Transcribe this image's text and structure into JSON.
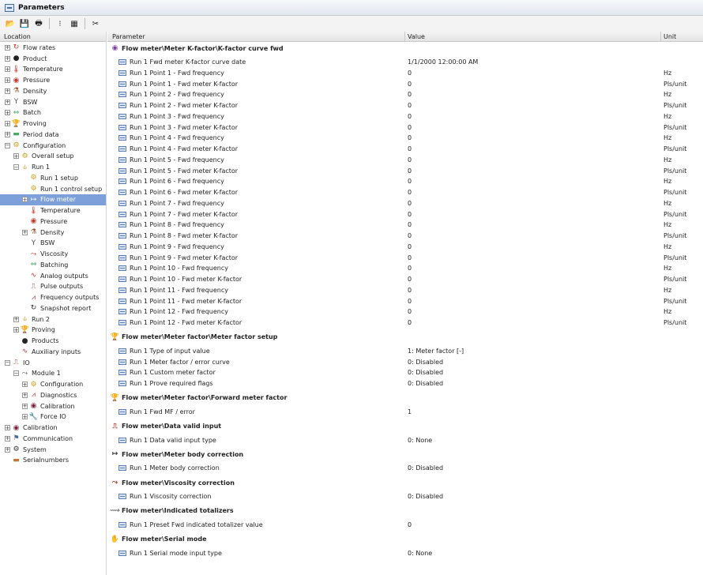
{
  "window": {
    "title": "Parameters"
  },
  "toolbar": [
    {
      "icon": "open-folder-icon",
      "glyph": "📂"
    },
    {
      "icon": "save-icon",
      "glyph": "💾"
    },
    {
      "icon": "print-icon",
      "glyph": "🖶"
    },
    {
      "icon": "sep"
    },
    {
      "icon": "tree-view-icon",
      "glyph": "⁝"
    },
    {
      "icon": "grid-view-icon",
      "glyph": "▦"
    },
    {
      "icon": "sep"
    },
    {
      "icon": "tools-icon",
      "glyph": "✂"
    }
  ],
  "tree": {
    "header": "Location",
    "nodes": [
      {
        "label": "Flow rates",
        "level": 0,
        "exp": "+",
        "icon": "flow-rates-icon",
        "glyph": "↻",
        "color": "#c0392b"
      },
      {
        "label": "Product",
        "level": 0,
        "exp": "+",
        "icon": "product-icon",
        "glyph": "●",
        "color": "#222"
      },
      {
        "label": "Temperature",
        "level": 0,
        "exp": "+",
        "icon": "temperature-icon",
        "glyph": "🌡",
        "color": "#c0392b"
      },
      {
        "label": "Pressure",
        "level": 0,
        "exp": "+",
        "icon": "pressure-icon",
        "glyph": "◉",
        "color": "#c0392b"
      },
      {
        "label": "Density",
        "level": 0,
        "exp": "+",
        "icon": "density-icon",
        "glyph": "⚗",
        "color": "#a0522d"
      },
      {
        "label": "BSW",
        "level": 0,
        "exp": "+",
        "icon": "bsw-icon",
        "glyph": "Y",
        "color": "#555"
      },
      {
        "label": "Batch",
        "level": 0,
        "exp": "+",
        "icon": "batch-icon",
        "glyph": "⇔",
        "color": "#4a6"
      },
      {
        "label": "Proving",
        "level": 0,
        "exp": "+",
        "icon": "proving-icon",
        "glyph": "🏆",
        "color": "#b8860b"
      },
      {
        "label": "Period data",
        "level": 0,
        "exp": "+",
        "icon": "period-data-icon",
        "glyph": "▬",
        "color": "#4a6"
      },
      {
        "label": "Configuration",
        "level": 0,
        "exp": "−",
        "icon": "configuration-icon",
        "glyph": "⚙",
        "color": "#d4a017"
      },
      {
        "label": "Overall setup",
        "level": 1,
        "exp": "+",
        "icon": "overall-setup-icon",
        "glyph": "⚙",
        "color": "#d4a017"
      },
      {
        "label": "Run 1",
        "level": 1,
        "exp": "−",
        "icon": "run-icon",
        "glyph": "⫝",
        "color": "#d4a017"
      },
      {
        "label": "Run 1 setup",
        "level": 2,
        "exp": "",
        "icon": "run-setup-icon",
        "glyph": "⚙",
        "color": "#d4a017"
      },
      {
        "label": "Run 1 control setup",
        "level": 2,
        "exp": "",
        "icon": "run-control-setup-icon",
        "glyph": "⚙",
        "color": "#d4a017"
      },
      {
        "label": "Flow meter",
        "level": 2,
        "exp": "+",
        "icon": "flow-meter-icon",
        "glyph": "↦",
        "color": "#fff",
        "selected": true
      },
      {
        "label": "Temperature",
        "level": 2,
        "exp": "",
        "icon": "temperature-icon",
        "glyph": "🌡",
        "color": "#c0392b"
      },
      {
        "label": "Pressure",
        "level": 2,
        "exp": "",
        "icon": "pressure-icon",
        "glyph": "◉",
        "color": "#c0392b"
      },
      {
        "label": "Density",
        "level": 2,
        "exp": "+",
        "icon": "density-icon",
        "glyph": "⚗",
        "color": "#a0522d"
      },
      {
        "label": "BSW",
        "level": 2,
        "exp": "",
        "icon": "bsw-icon",
        "glyph": "Y",
        "color": "#555"
      },
      {
        "label": "Viscosity",
        "level": 2,
        "exp": "",
        "icon": "viscosity-icon",
        "glyph": "⤳",
        "color": "#c0392b"
      },
      {
        "label": "Batching",
        "level": 2,
        "exp": "",
        "icon": "batching-icon",
        "glyph": "⇔",
        "color": "#4a6"
      },
      {
        "label": "Analog outputs",
        "level": 2,
        "exp": "",
        "icon": "analog-outputs-icon",
        "glyph": "∿",
        "color": "#c0392b"
      },
      {
        "label": "Pulse outputs",
        "level": 2,
        "exp": "",
        "icon": "pulse-outputs-icon",
        "glyph": "⎍",
        "color": "#c0392b"
      },
      {
        "label": "Frequency outputs",
        "level": 2,
        "exp": "",
        "icon": "frequency-outputs-icon",
        "glyph": "⩘",
        "color": "#c0392b"
      },
      {
        "label": "Snapshot report",
        "level": 2,
        "exp": "",
        "icon": "snapshot-report-icon",
        "glyph": "↻",
        "color": "#333"
      },
      {
        "label": "Run 2",
        "level": 1,
        "exp": "+",
        "icon": "run-icon",
        "glyph": "⫝",
        "color": "#d4a017"
      },
      {
        "label": "Proving",
        "level": 1,
        "exp": "+",
        "icon": "proving-icon",
        "glyph": "🏆",
        "color": "#b8860b"
      },
      {
        "label": "Products",
        "level": 1,
        "exp": "",
        "icon": "products-icon",
        "glyph": "●",
        "color": "#222"
      },
      {
        "label": "Auxiliary inputs",
        "level": 1,
        "exp": "",
        "icon": "auxiliary-inputs-icon",
        "glyph": "∿",
        "color": "#c0392b"
      },
      {
        "label": "IO",
        "level": 0,
        "exp": "−",
        "icon": "io-icon",
        "glyph": "⎍",
        "color": "#c0392b"
      },
      {
        "label": "Module 1",
        "level": 1,
        "exp": "−",
        "icon": "module-icon",
        "glyph": "⤳",
        "color": "#555"
      },
      {
        "label": "Configuration",
        "level": 2,
        "exp": "+",
        "icon": "configuration-icon",
        "glyph": "⚙",
        "color": "#d4a017"
      },
      {
        "label": "Diagnostics",
        "level": 2,
        "exp": "+",
        "icon": "diagnostics-icon",
        "glyph": "⩘",
        "color": "#c0392b"
      },
      {
        "label": "Calibration",
        "level": 2,
        "exp": "+",
        "icon": "calibration-icon",
        "glyph": "◉",
        "color": "#7a1f3d"
      },
      {
        "label": "Force IO",
        "level": 2,
        "exp": "+",
        "icon": "force-io-icon",
        "glyph": "🔧",
        "color": "#555"
      },
      {
        "label": "Calibration",
        "level": 0,
        "exp": "+",
        "icon": "calibration-icon",
        "glyph": "◉",
        "color": "#7a1f3d"
      },
      {
        "label": "Communication",
        "level": 0,
        "exp": "+",
        "icon": "communication-icon",
        "glyph": "⚑",
        "color": "#4a6b9a"
      },
      {
        "label": "System",
        "level": 0,
        "exp": "+",
        "icon": "system-icon",
        "glyph": "⚙",
        "color": "#333"
      },
      {
        "label": "Serialnumbers",
        "level": 0,
        "exp": "",
        "icon": "serialnumbers-icon",
        "glyph": "▬",
        "color": "#c87533"
      }
    ]
  },
  "grid": {
    "headers": {
      "parameter": "Parameter",
      "value": "Value",
      "unit": "Unit"
    },
    "items": [
      {
        "kind": "section",
        "label": "Flow meter\\Meter K-factor\\K-factor curve fwd",
        "icon": "k-factor-icon",
        "glyph": "◉",
        "color": "#7a3fa0"
      },
      {
        "kind": "row",
        "param": "Run 1 Fwd meter K-factor curve date",
        "value": "1/1/2000 12:00:00 AM",
        "unit": ""
      },
      {
        "kind": "row",
        "param": "Run 1 Point 1 - Fwd frequency",
        "value": "0",
        "unit": "Hz"
      },
      {
        "kind": "row",
        "param": "Run 1 Point 1 - Fwd meter K-factor",
        "value": "0",
        "unit": "Pls/unit"
      },
      {
        "kind": "row",
        "param": "Run 1 Point 2 - Fwd frequency",
        "value": "0",
        "unit": "Hz"
      },
      {
        "kind": "row",
        "param": "Run 1 Point 2 - Fwd meter K-factor",
        "value": "0",
        "unit": "Pls/unit"
      },
      {
        "kind": "row",
        "param": "Run 1 Point 3 - Fwd frequency",
        "value": "0",
        "unit": "Hz"
      },
      {
        "kind": "row",
        "param": "Run 1 Point 3 - Fwd meter K-factor",
        "value": "0",
        "unit": "Pls/unit"
      },
      {
        "kind": "row",
        "param": "Run 1 Point 4 - Fwd frequency",
        "value": "0",
        "unit": "Hz"
      },
      {
        "kind": "row",
        "param": "Run 1 Point 4 - Fwd meter K-factor",
        "value": "0",
        "unit": "Pls/unit"
      },
      {
        "kind": "row",
        "param": "Run 1 Point 5 - Fwd frequency",
        "value": "0",
        "unit": "Hz"
      },
      {
        "kind": "row",
        "param": "Run 1 Point 5 - Fwd meter K-factor",
        "value": "0",
        "unit": "Pls/unit"
      },
      {
        "kind": "row",
        "param": "Run 1 Point 6 - Fwd frequency",
        "value": "0",
        "unit": "Hz"
      },
      {
        "kind": "row",
        "param": "Run 1 Point 6 - Fwd meter K-factor",
        "value": "0",
        "unit": "Pls/unit"
      },
      {
        "kind": "row",
        "param": "Run 1 Point 7 - Fwd frequency",
        "value": "0",
        "unit": "Hz"
      },
      {
        "kind": "row",
        "param": "Run 1 Point 7 - Fwd meter K-factor",
        "value": "0",
        "unit": "Pls/unit"
      },
      {
        "kind": "row",
        "param": "Run 1 Point 8 - Fwd frequency",
        "value": "0",
        "unit": "Hz"
      },
      {
        "kind": "row",
        "param": "Run 1 Point 8 - Fwd meter K-factor",
        "value": "0",
        "unit": "Pls/unit"
      },
      {
        "kind": "row",
        "param": "Run 1 Point 9 - Fwd frequency",
        "value": "0",
        "unit": "Hz"
      },
      {
        "kind": "row",
        "param": "Run 1 Point 9 - Fwd meter K-factor",
        "value": "0",
        "unit": "Pls/unit"
      },
      {
        "kind": "row",
        "param": "Run 1 Point 10 - Fwd frequency",
        "value": "0",
        "unit": "Hz"
      },
      {
        "kind": "row",
        "param": "Run 1 Point 10 - Fwd meter K-factor",
        "value": "0",
        "unit": "Pls/unit"
      },
      {
        "kind": "row",
        "param": "Run 1 Point 11 - Fwd frequency",
        "value": "0",
        "unit": "Hz"
      },
      {
        "kind": "row",
        "param": "Run 1 Point 11 - Fwd meter K-factor",
        "value": "0",
        "unit": "Pls/unit"
      },
      {
        "kind": "row",
        "param": "Run 1 Point 12 - Fwd frequency",
        "value": "0",
        "unit": "Hz"
      },
      {
        "kind": "row",
        "param": "Run 1 Point 12 - Fwd meter K-factor",
        "value": "0",
        "unit": "Pls/unit"
      },
      {
        "kind": "section",
        "label": "Flow meter\\Meter factor\\Meter factor setup",
        "icon": "trophy-icon",
        "glyph": "🏆",
        "color": "#b8860b"
      },
      {
        "kind": "row",
        "param": "Run 1 Type of input value",
        "value": "1: Meter factor [-]",
        "unit": ""
      },
      {
        "kind": "row",
        "param": "Run 1 Meter factor / error curve",
        "value": "0: Disabled",
        "unit": ""
      },
      {
        "kind": "row",
        "param": "Run 1 Custom meter factor",
        "value": "0: Disabled",
        "unit": ""
      },
      {
        "kind": "row",
        "param": "Run 1 Prove required flags",
        "value": "0: Disabled",
        "unit": ""
      },
      {
        "kind": "section",
        "label": "Flow meter\\Meter factor\\Forward meter factor",
        "icon": "trophy-icon",
        "glyph": "🏆",
        "color": "#b8860b"
      },
      {
        "kind": "row",
        "param": "Run 1 Fwd MF / error",
        "value": "1",
        "unit": ""
      },
      {
        "kind": "section",
        "label": "Flow meter\\Data valid input",
        "icon": "pulse-icon",
        "glyph": "⎍",
        "color": "#c0392b"
      },
      {
        "kind": "row",
        "param": "Run 1 Data valid input type",
        "value": "0: None",
        "unit": ""
      },
      {
        "kind": "section",
        "label": "Flow meter\\Meter body correction",
        "icon": "meter-body-icon",
        "glyph": "↦",
        "color": "#333"
      },
      {
        "kind": "row",
        "param": "Run 1 Meter body correction",
        "value": "0: Disabled",
        "unit": ""
      },
      {
        "kind": "section",
        "label": "Flow meter\\Viscosity correction",
        "icon": "viscosity-icon",
        "glyph": "⤳",
        "color": "#c0392b"
      },
      {
        "kind": "row",
        "param": "Run 1 Viscosity correction",
        "value": "0: Disabled",
        "unit": ""
      },
      {
        "kind": "section",
        "label": "Flow meter\\Indicated totalizers",
        "icon": "totalizer-icon",
        "glyph": "⟿",
        "color": "#777"
      },
      {
        "kind": "row",
        "param": "Run 1 Preset Fwd indicated totalizer value",
        "value": "0",
        "unit": ""
      },
      {
        "kind": "section",
        "label": "Flow meter\\Serial mode",
        "icon": "serial-mode-icon",
        "glyph": "✋",
        "color": "#333"
      },
      {
        "kind": "row",
        "param": "Run 1 Serial mode input type",
        "value": "0: None",
        "unit": ""
      }
    ]
  }
}
